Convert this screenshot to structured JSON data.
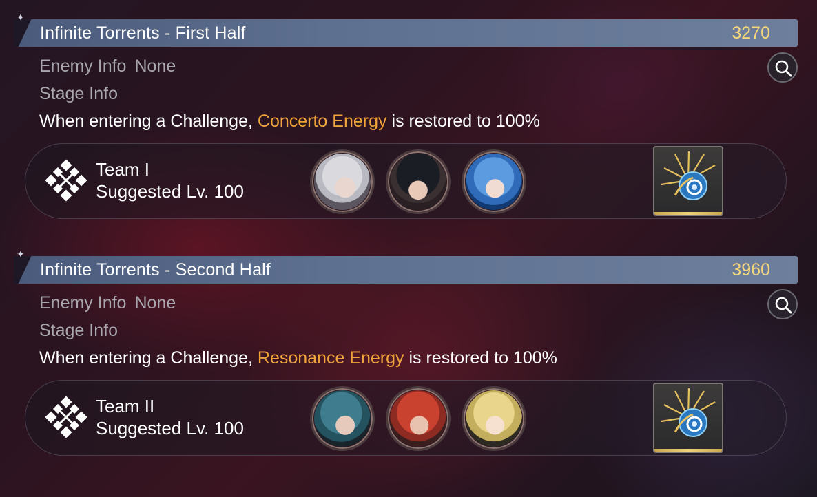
{
  "sections": [
    {
      "title": "Infinite Torrents - First Half",
      "score": "3270",
      "enemy_label": "Enemy Info",
      "enemy_value": "None",
      "stage_label": "Stage Info",
      "effect_prefix": "When entering a Challenge,",
      "effect_highlight": "Concerto Energy",
      "effect_suffix": "is restored to 100%",
      "team_name": "Team I",
      "team_level": "Suggested Lv. 100",
      "members": [
        "white-haired-character-portrait",
        "black-haired-character-portrait",
        "blue-haired-character-portrait"
      ],
      "echo": "echo-seahorse-icon"
    },
    {
      "title": "Infinite Torrents - Second Half",
      "score": "3960",
      "enemy_label": "Enemy Info",
      "enemy_value": "None",
      "stage_label": "Stage Info",
      "effect_prefix": "When entering a Challenge,",
      "effect_highlight": "Resonance Energy",
      "effect_suffix": "is restored to 100%",
      "team_name": "Team II",
      "team_level": "Suggested Lv. 100",
      "members": [
        "teal-haired-character-portrait",
        "red-haired-character-portrait",
        "blonde-haired-character-portrait"
      ],
      "echo": "echo-seahorse-icon"
    }
  ],
  "colors": {
    "score": "#f5d67a",
    "highlight": "#f0a53c",
    "muted_label": "#a9a7ad",
    "title_bar": "#5e7090"
  }
}
